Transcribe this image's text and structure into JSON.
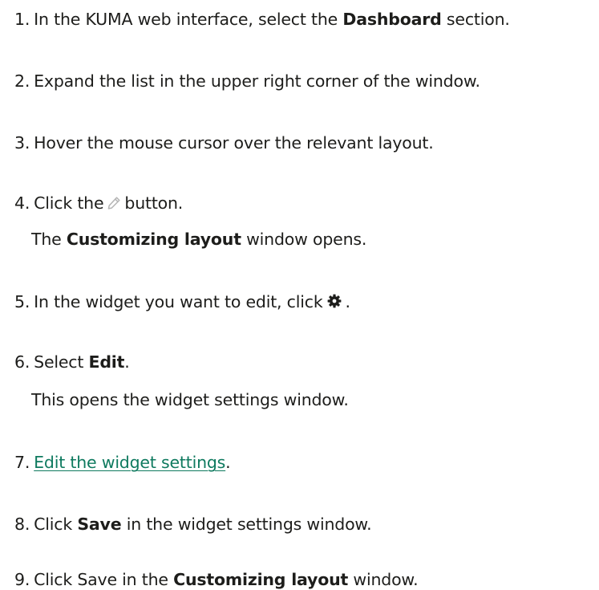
{
  "steps": [
    {
      "num": "1.",
      "text_pre": "In the KUMA web interface, select the ",
      "bold": "Dashboard",
      "text_post": " section."
    },
    {
      "num": "2.",
      "text": "Expand the list in the upper right corner of the window."
    },
    {
      "num": "3.",
      "text": "Hover the mouse cursor over the relevant layout."
    },
    {
      "num": "4.",
      "text_pre": "Click the",
      "icon": "pencil-icon",
      "text_post": "button.",
      "note_bold": "Customizing layout",
      "note_post": " window opens.",
      "note_pre": "The "
    },
    {
      "num": "5.",
      "text_pre": "In the widget you want to edit, click",
      "icon": "gear-icon",
      "text_post": "."
    },
    {
      "num": "6.",
      "text_pre": "Select ",
      "bold": "Edit",
      "text_post": ".",
      "note": "This opens the widget settings window."
    },
    {
      "num": "7.",
      "link": "Edit the widget settings",
      "text_post": "."
    },
    {
      "num": "8.",
      "text_pre": "Click ",
      "bold": "Save",
      "text_post": " in the widget settings window."
    },
    {
      "num": "9.",
      "text_pre": "Click Save in the ",
      "bold": "Customizing layout",
      "text_post": " window."
    }
  ],
  "colors": {
    "text": "#1d1d1b",
    "link": "#0f7a5f",
    "icon_pencil": "#b5b5b5",
    "icon_gear": "#1d1d1b"
  }
}
